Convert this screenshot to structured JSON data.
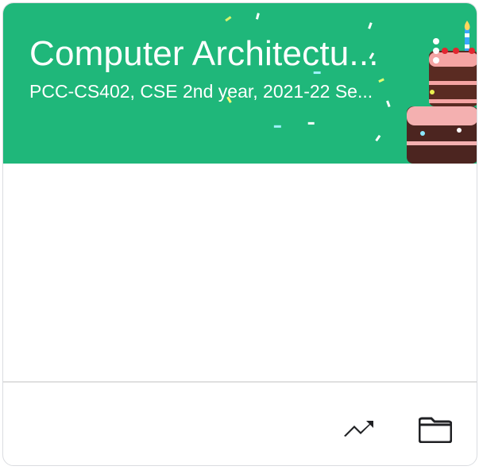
{
  "course": {
    "title": "Computer Architectu...",
    "subtitle": "PCC-CS402, CSE 2nd year, 2021-22 Se...",
    "banner_color": "#1fb77a",
    "banner_theme": "birthday-cake"
  },
  "actions": {
    "menu_icon": "more-vert-icon",
    "gradebook_icon": "trending-up-icon",
    "folder_icon": "folder-icon"
  }
}
